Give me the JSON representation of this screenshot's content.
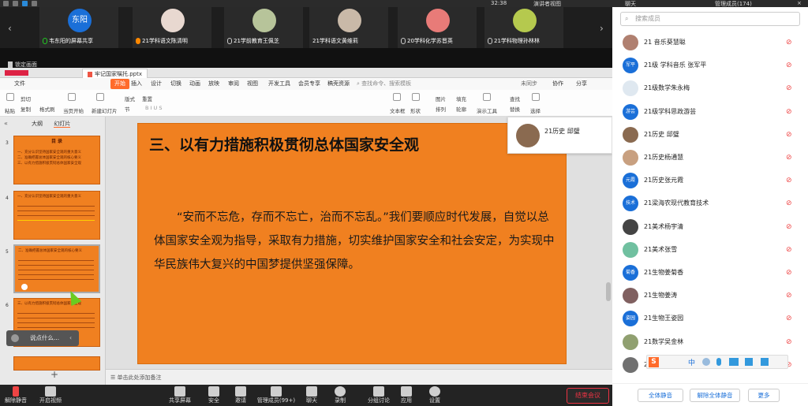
{
  "topbar": {
    "time": "32:38",
    "view_mode": "演讲者视图"
  },
  "video_strip": {
    "tiles": [
      {
        "label": "韦东阳的屏幕共享",
        "avatar_text": "东阳",
        "color": "#1a6fd8"
      },
      {
        "label": "21学科语文陈清明",
        "avatar_text": "",
        "color": "#e8d8d0"
      },
      {
        "label": "21学前教育王佩芝",
        "avatar_text": "",
        "color": "#b7c49a"
      },
      {
        "label": "21学科语文黄维莉",
        "avatar_text": "",
        "color": "#c9b9a8"
      },
      {
        "label": "20学科化学苏晋英",
        "avatar_text": "",
        "color": "#e87b78"
      },
      {
        "label": "21学科物理孙林林",
        "avatar_text": "",
        "color": "#b5c94e"
      }
    ]
  },
  "pin_label": "锁定画面",
  "wps": {
    "doc_tab": "牢记国家嘱托.pptx",
    "ribbon_tabs": [
      "文件",
      "开始",
      "插入",
      "设计",
      "切换",
      "动画",
      "放映",
      "审阅",
      "视图",
      "开发工具",
      "会员专享",
      "稿壳资源"
    ],
    "search_placeholder": "查找命令、搜索模板",
    "ribbon_right": [
      "未同步",
      "协作",
      "分享"
    ],
    "ribbon": {
      "paste": "粘贴",
      "cut": "剪切",
      "copy": "复制",
      "format_painter": "格式刷",
      "from_current": "当页开始",
      "new_slide": "新建幻灯片",
      "layout": "版式",
      "section": "节",
      "reset": "重置",
      "text_box": "文本框",
      "shape": "形状",
      "arrange": "排列",
      "outline": "轮廓",
      "picture": "图片",
      "fill": "填充",
      "presenter_tools": "演示工具",
      "replace": "替换",
      "select": "选择",
      "find": "查找"
    },
    "panel_tabs": {
      "outline": "大纲",
      "slides": "幻灯片"
    },
    "thumbs": [
      {
        "num": "3",
        "title": "目 录",
        "lines": [
          "一、充分认识坚持国家安全观的重大意义",
          "二、准确把握总体国家安全观的核心要义",
          "三、以有力措施积极贯彻总体国家安全观"
        ]
      },
      {
        "num": "4",
        "title": "一、充分认识坚持国家安全观的重大意义",
        "lines": []
      },
      {
        "num": "5",
        "title": "二、准确把握总体国家安全观的核心要义",
        "lines": []
      },
      {
        "num": "6",
        "title": "三、以有力措施积极贯彻总体国家安全观",
        "lines": []
      }
    ],
    "add_slide": "+",
    "comment_placeholder": "说点什么...",
    "slide": {
      "title": "三、以有力措施积极贯彻总体国家安全观",
      "body": "“安而不忘危，存而不忘亡，治而不忘乱。”我们要顺应时代发展，自觉以总体国家安全观为指导，采取有力措施，切实维护国家安全和社会安定，为实现中华民族伟大复兴的中国梦提供坚强保障。"
    },
    "presenter": "21历史 邱璧",
    "note_hint": "单击此处添加备注"
  },
  "bottombar": {
    "items": [
      "解除静音",
      "开启视频",
      "共享屏幕",
      "安全",
      "邀请",
      "管理成员(99+)",
      "聊天",
      "录制",
      "分组讨论",
      "应用",
      "设置"
    ],
    "end": "结束会议"
  },
  "right_panel": {
    "tab_chat": "聊天",
    "tab_members": "管理成员(174)",
    "search_placeholder": "搜索成员",
    "members": [
      {
        "name": "21 音乐葵慧聪",
        "avatar": "",
        "color": "#b08070"
      },
      {
        "name": "21级 学科音乐 张军平",
        "avatar": "军平",
        "color": "#1a6fd8"
      },
      {
        "name": "21级数学朱永梅",
        "avatar": "",
        "color": "#dfe8f0"
      },
      {
        "name": "21级学科思政游芸",
        "avatar": "游芸",
        "color": "#1a6fd8"
      },
      {
        "name": "21历史 邱璧",
        "avatar": "",
        "color": "#8a6a50"
      },
      {
        "name": "21历史杨通慧",
        "avatar": "",
        "color": "#c8a080"
      },
      {
        "name": "21历史张元霞",
        "avatar": "元霞",
        "color": "#1a6fd8"
      },
      {
        "name": "21梁海农现代教育技术",
        "avatar": "技术",
        "color": "#1a6fd8"
      },
      {
        "name": "21美术杨宇清",
        "avatar": "",
        "color": "#444444"
      },
      {
        "name": "21美术张雪",
        "avatar": "",
        "color": "#70c0a0"
      },
      {
        "name": "21生物姜菊香",
        "avatar": "菊香",
        "color": "#1a6fd8"
      },
      {
        "name": "21生物姜涛",
        "avatar": "",
        "color": "#806060"
      },
      {
        "name": "21生物王姿园",
        "avatar": "姿园",
        "color": "#1a6fd8"
      },
      {
        "name": "21数学吴金林",
        "avatar": "",
        "color": "#90a070"
      },
      {
        "name": "21数学杨美",
        "avatar": "",
        "color": "#707070"
      }
    ],
    "footer": {
      "mute_all": "全体静音",
      "unmute_all": "解除全体静音",
      "more": "更多"
    }
  },
  "ime": {
    "lang": "中"
  }
}
